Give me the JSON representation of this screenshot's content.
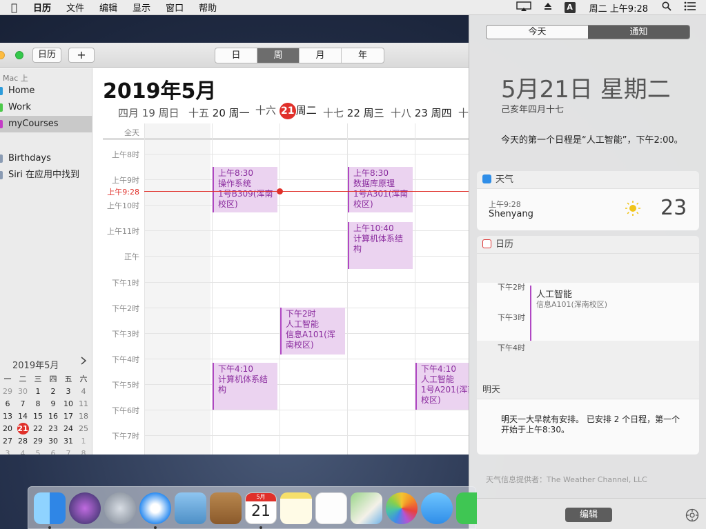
{
  "menubar": {
    "items": [
      "日历",
      "文件",
      "编辑",
      "显示",
      "窗口",
      "帮助"
    ],
    "clock": "周二 上午9:28",
    "input_source": "A"
  },
  "toolbar": {
    "calendars_button": "日历",
    "add_button": "+",
    "views": [
      "日",
      "周",
      "月",
      "年"
    ],
    "active_view": "周"
  },
  "sidebar": {
    "group": "Mac 上",
    "calendars": [
      {
        "label": "Home",
        "color": "#2d9cdb"
      },
      {
        "label": "Work",
        "color": "#4cc94a"
      },
      {
        "label": "myCourses",
        "color": "#c43cc6"
      },
      {
        "label": "Birthdays",
        "color": "#8a9bb3"
      },
      {
        "label": "Siri 在应用中找到",
        "color": "#8a9bb3"
      }
    ],
    "selected": "myCourses"
  },
  "minical": {
    "title": "2019年5月",
    "next_icon": "chevron-right-icon",
    "weekdays": [
      "一",
      "二",
      "三",
      "四",
      "五",
      "六"
    ],
    "rows": [
      [
        "29",
        "30",
        "1",
        "2",
        "3",
        "4"
      ],
      [
        "6",
        "7",
        "8",
        "9",
        "10",
        "11"
      ],
      [
        "13",
        "14",
        "15",
        "16",
        "17",
        "18"
      ],
      [
        "20",
        "21",
        "22",
        "23",
        "24",
        "25"
      ],
      [
        "27",
        "28",
        "29",
        "30",
        "31",
        "1"
      ],
      [
        "3",
        "4",
        "5",
        "6",
        "7",
        "8"
      ]
    ],
    "today": "21"
  },
  "main": {
    "title": "2019年5月",
    "day_headers": [
      {
        "lunar": "四月",
        "date": "19 周日"
      },
      {
        "lunar": "十五",
        "date": "20 周一"
      },
      {
        "lunar": "十六",
        "num": "21",
        "date": "周二"
      },
      {
        "lunar": "十七",
        "date": "22 周三"
      },
      {
        "lunar": "十八",
        "date": "23 周四"
      },
      {
        "lunar": "十"
      }
    ],
    "allday_label": "全天",
    "hours": [
      "上午8时",
      "上午9时",
      "上午10时",
      "上午11时",
      "正午",
      "下午1时",
      "下午2时",
      "下午3时",
      "下午4时",
      "下午5时",
      "下午6时",
      "下午7时"
    ],
    "now_label": "上午9:28",
    "events": [
      {
        "day": 1,
        "start": 8.5,
        "end": 10.3,
        "time": "上午8:30",
        "title": "操作系统",
        "location": "1号B309(浑南校区)"
      },
      {
        "day": 3,
        "start": 8.5,
        "end": 10.3,
        "time": "上午8:30",
        "title": "数据库原理",
        "location": "1号A301(浑南校区)"
      },
      {
        "day": 3,
        "start": 10.667,
        "end": 12.5,
        "time": "上午10:40",
        "title": "计算机体系结构",
        "location": ""
      },
      {
        "day": 2,
        "start": 14.0,
        "end": 15.833,
        "time": "下午2时",
        "title": "人工智能",
        "location": "信息A101(浑南校区)"
      },
      {
        "day": 1,
        "start": 16.167,
        "end": 18.0,
        "time": "下午4:10",
        "title": "计算机体系结构",
        "location": ""
      },
      {
        "day": 4,
        "start": 16.167,
        "end": 18.0,
        "time": "下午4:10",
        "title": "人工智能",
        "location": "1号A201(浑南校区)"
      }
    ]
  },
  "nc": {
    "tabs": [
      "今天",
      "通知"
    ],
    "active_tab": "通知",
    "date": "5月21日 星期二",
    "lunar": "己亥年四月十七",
    "first_event": "今天的第一个日程是“人工智能”，下午2:00。",
    "weather": {
      "title": "天气",
      "time": "上午9:28",
      "city": "Shenyang",
      "temp": "23",
      "icon": "sun-icon"
    },
    "calendar": {
      "title": "日历",
      "hours": [
        "下午2时",
        "下午3时",
        "下午4时"
      ],
      "event_title": "人工智能",
      "event_location": "信息A101(浑南校区)"
    },
    "tomorrow": {
      "title": "明天",
      "text": "明天一大早就有安排。 已安排 2 个日程，第一个开始于上午8:30。"
    },
    "provider": "天气信息提供者：The Weather Channel, LLC",
    "edit_button": "编辑"
  },
  "dock": {
    "apps": [
      "finder-icon",
      "siri-icon",
      "launchpad-icon",
      "safari-icon",
      "mail-icon",
      "contacts-icon",
      "calendar-icon",
      "notes-icon",
      "reminders-icon",
      "maps-icon",
      "photos-icon",
      "messages-icon",
      "facetime-icon"
    ],
    "calendar_month": "5月",
    "calendar_day": "21"
  },
  "colors": {
    "accent_red": "#e0302a",
    "course_purple": "#b047c3"
  }
}
